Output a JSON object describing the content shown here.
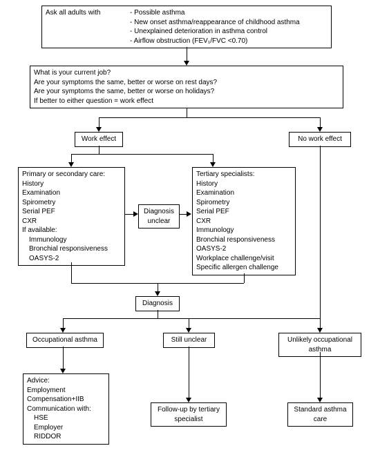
{
  "box1": {
    "lead": "Ask all adults with",
    "items": [
      "Possible asthma",
      "New onset asthma/reappearance of childhood asthma",
      "Unexplained deterioration in asthma control",
      "Airflow obstruction (FEV₁/FVC <0.70)"
    ]
  },
  "box2": {
    "lines": [
      "What is your current job?",
      "Are your symptoms the same, better or worse on rest days?",
      "Are your symptoms the same, better or worse on holidays?",
      "If better to either question = work effect"
    ]
  },
  "work_effect": "Work effect",
  "no_work_effect": "No work effect",
  "primary_care": {
    "title": "Primary or secondary care:",
    "items": [
      "History",
      "Examination",
      "Spirometry",
      "Serial PEF",
      "CXR"
    ],
    "if_available": "If available:",
    "avail_items": [
      "Immunology",
      "Bronchial responsiveness",
      "OASYS-2"
    ]
  },
  "diagnosis_unclear": "Diagnosis unclear",
  "tertiary": {
    "title": "Tertiary specialists:",
    "items": [
      "History",
      "Examination",
      "Spirometry",
      "Serial PEF",
      "CXR",
      "Immunology",
      "Bronchial responsiveness",
      "OASYS-2",
      "Workplace challenge/visit",
      "Specific allergen challenge"
    ]
  },
  "diagnosis": "Diagnosis",
  "occ_asthma": "Occupational asthma",
  "still_unclear": "Still unclear",
  "unlikely": "Unlikely occupational asthma",
  "advice": {
    "lines": [
      "Advice:",
      "Employment",
      "Compensation+IIB",
      "Communication with:"
    ],
    "sub": [
      "HSE",
      "Employer",
      "RIDDOR"
    ]
  },
  "followup": "Follow-up by tertiary specialist",
  "standard_care": "Standard asthma care"
}
